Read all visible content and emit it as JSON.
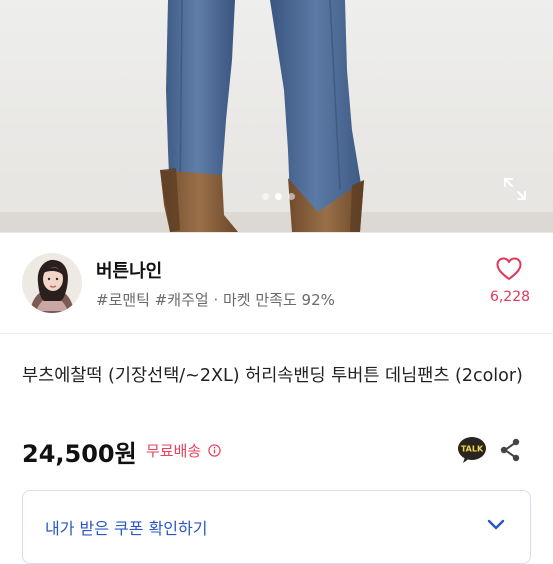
{
  "carousel": {
    "dots": 3,
    "active_index": 1
  },
  "seller": {
    "shop_name": "버튼나인",
    "tags": "#로맨틱 #캐주얼 · 마켓 만족도 92%",
    "like_count": "6,228"
  },
  "product": {
    "title": "부츠에찰떡 (기장선택/~2XL) 허리속밴딩 투버튼 데님팬츠 (2color)",
    "price": "24,500원",
    "shipping": "무료배송"
  },
  "icons": {
    "talk": "TALK"
  },
  "coupon": {
    "label": "내가 받은 쿠폰 확인하기"
  },
  "colors": {
    "accent_pink": "#e0375a",
    "coupon_blue": "#2a56c6",
    "denim": "#4d6b95",
    "boot_brown": "#8e6541"
  }
}
